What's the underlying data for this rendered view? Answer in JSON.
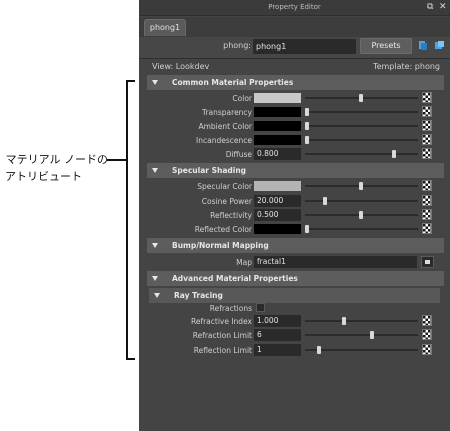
{
  "callout": {
    "line1": "マテリアル ノードの",
    "line2": "アトリビュート"
  },
  "panel": {
    "title": "Property Editor",
    "tab": "phong1",
    "node_type_label": "phong:",
    "node_name": "phong1",
    "presets_label": "Presets",
    "view_label": "View: Lookdev",
    "template_label": "Template: phong"
  },
  "sections": {
    "common": "Common Material Properties",
    "specular": "Specular Shading",
    "bump": "Bump/Normal Mapping",
    "advanced": "Advanced Material Properties",
    "raytracing": "Ray Tracing"
  },
  "common": {
    "color_label": "Color",
    "color_value": 0.7,
    "transparency_label": "Transparency",
    "transparency_value": 0.0,
    "ambient_label": "Ambient Color",
    "ambient_value": 0.0,
    "incandescence_label": "Incandescence",
    "incandescence_value": 0.0,
    "diffuse_label": "Diffuse",
    "diffuse_value": "0.800"
  },
  "specular": {
    "specular_color_label": "Specular Color",
    "specular_color_value": 0.5,
    "cosine_power_label": "Cosine Power",
    "cosine_power_value": "20.000",
    "reflectivity_label": "Reflectivity",
    "reflectivity_value": "0.500",
    "reflected_color_label": "Reflected Color",
    "reflected_color_value": 0.0
  },
  "bump": {
    "map_label": "Map",
    "map_value": "fractal1"
  },
  "raytracing": {
    "refractions_label": "Refractions",
    "refractions_checked": false,
    "refractive_index_label": "Refractive Index",
    "refractive_index_value": "1.000",
    "refraction_limit_label": "Refraction Limit",
    "refraction_limit_value": "6",
    "reflection_limit_label": "Reflection Limit",
    "reflection_limit_value": "1"
  },
  "colors": {
    "panel_bg": "#444444",
    "section_header": "#5d5d5d",
    "field_bg": "#2a2a2a",
    "color_swatch": "#c8c8c8",
    "specular_swatch": "#b4b4b4"
  }
}
